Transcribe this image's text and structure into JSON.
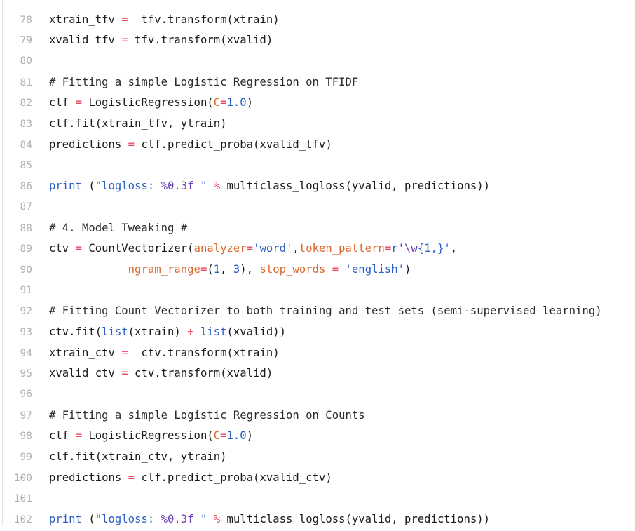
{
  "cell": {
    "language": "python",
    "background": "#ffffff",
    "line_number_color": "#b0b0b0",
    "gutter_rule_color": "#e3e3e3"
  },
  "colors": {
    "plain": "#1a1a1a",
    "comment": "#2b2b2b",
    "builtin": "#2b5fc4",
    "string": "#2b5fc4",
    "number": "#2b5fc4",
    "kwarg": "#d9662b",
    "operator": "#e8455f",
    "escape": "#6a3fb5"
  },
  "lines": [
    {
      "number": "",
      "clipped": true,
      "tokens": [
        {
          "t": "plain",
          "v": ""
        }
      ]
    },
    {
      "number": "78",
      "tokens": [
        {
          "t": "plain",
          "v": "xtrain_tfv "
        },
        {
          "t": "op",
          "v": "="
        },
        {
          "t": "plain",
          "v": "  tfv.transform(xtrain)"
        }
      ]
    },
    {
      "number": "79",
      "tokens": [
        {
          "t": "plain",
          "v": "xvalid_tfv "
        },
        {
          "t": "op",
          "v": "="
        },
        {
          "t": "plain",
          "v": " tfv.transform(xvalid)"
        }
      ]
    },
    {
      "number": "80",
      "tokens": []
    },
    {
      "number": "81",
      "tokens": [
        {
          "t": "comment",
          "v": "# Fitting a simple Logistic Regression on TFIDF"
        }
      ]
    },
    {
      "number": "82",
      "tokens": [
        {
          "t": "plain",
          "v": "clf "
        },
        {
          "t": "op",
          "v": "="
        },
        {
          "t": "plain",
          "v": " LogisticRegression("
        },
        {
          "t": "kwarg",
          "v": "C"
        },
        {
          "t": "op",
          "v": "="
        },
        {
          "t": "number",
          "v": "1.0"
        },
        {
          "t": "plain",
          "v": ")"
        }
      ]
    },
    {
      "number": "83",
      "tokens": [
        {
          "t": "plain",
          "v": "clf.fit(xtrain_tfv, ytrain)"
        }
      ]
    },
    {
      "number": "84",
      "tokens": [
        {
          "t": "plain",
          "v": "predictions "
        },
        {
          "t": "op",
          "v": "="
        },
        {
          "t": "plain",
          "v": " clf.predict_proba(xvalid_tfv)"
        }
      ]
    },
    {
      "number": "85",
      "tokens": []
    },
    {
      "number": "86",
      "tokens": [
        {
          "t": "builtin",
          "v": "print"
        },
        {
          "t": "plain",
          "v": " ("
        },
        {
          "t": "string",
          "v": "\"logloss: "
        },
        {
          "t": "esc",
          "v": "%0.3f"
        },
        {
          "t": "string",
          "v": " \""
        },
        {
          "t": "plain",
          "v": " "
        },
        {
          "t": "op",
          "v": "%"
        },
        {
          "t": "plain",
          "v": " multiclass_logloss(yvalid, predictions))"
        }
      ]
    },
    {
      "number": "87",
      "tokens": []
    },
    {
      "number": "88",
      "tokens": [
        {
          "t": "comment",
          "v": "# 4. Model Tweaking #"
        }
      ]
    },
    {
      "number": "89",
      "tokens": [
        {
          "t": "plain",
          "v": "ctv "
        },
        {
          "t": "op",
          "v": "="
        },
        {
          "t": "plain",
          "v": " CountVectorizer("
        },
        {
          "t": "kwarg",
          "v": "analyzer"
        },
        {
          "t": "op",
          "v": "="
        },
        {
          "t": "string",
          "v": "'word'"
        },
        {
          "t": "plain",
          "v": ","
        },
        {
          "t": "kwarg",
          "v": "token_pattern"
        },
        {
          "t": "op",
          "v": "="
        },
        {
          "t": "string",
          "v": "r'"
        },
        {
          "t": "esc",
          "v": "\\w"
        },
        {
          "t": "string",
          "v": "{1,}'"
        },
        {
          "t": "plain",
          "v": ","
        }
      ]
    },
    {
      "number": "90",
      "tokens": [
        {
          "t": "plain",
          "v": "            "
        },
        {
          "t": "kwarg",
          "v": "ngram_range"
        },
        {
          "t": "op",
          "v": "="
        },
        {
          "t": "plain",
          "v": "("
        },
        {
          "t": "number",
          "v": "1"
        },
        {
          "t": "plain",
          "v": ", "
        },
        {
          "t": "number",
          "v": "3"
        },
        {
          "t": "plain",
          "v": "), "
        },
        {
          "t": "kwarg",
          "v": "stop_words"
        },
        {
          "t": "plain",
          "v": " "
        },
        {
          "t": "op",
          "v": "="
        },
        {
          "t": "plain",
          "v": " "
        },
        {
          "t": "string",
          "v": "'english'"
        },
        {
          "t": "plain",
          "v": ")"
        }
      ]
    },
    {
      "number": "91",
      "tokens": []
    },
    {
      "number": "92",
      "tokens": [
        {
          "t": "comment",
          "v": "# Fitting Count Vectorizer to both training and test sets (semi-supervised learning)"
        }
      ]
    },
    {
      "number": "93",
      "tokens": [
        {
          "t": "plain",
          "v": "ctv.fit("
        },
        {
          "t": "builtin",
          "v": "list"
        },
        {
          "t": "plain",
          "v": "(xtrain) "
        },
        {
          "t": "op",
          "v": "+"
        },
        {
          "t": "plain",
          "v": " "
        },
        {
          "t": "builtin",
          "v": "list"
        },
        {
          "t": "plain",
          "v": "(xvalid))"
        }
      ]
    },
    {
      "number": "94",
      "tokens": [
        {
          "t": "plain",
          "v": "xtrain_ctv "
        },
        {
          "t": "op",
          "v": "="
        },
        {
          "t": "plain",
          "v": "  ctv.transform(xtrain)"
        }
      ]
    },
    {
      "number": "95",
      "tokens": [
        {
          "t": "plain",
          "v": "xvalid_ctv "
        },
        {
          "t": "op",
          "v": "="
        },
        {
          "t": "plain",
          "v": " ctv.transform(xvalid)"
        }
      ]
    },
    {
      "number": "96",
      "tokens": []
    },
    {
      "number": "97",
      "tokens": [
        {
          "t": "comment",
          "v": "# Fitting a simple Logistic Regression on Counts"
        }
      ]
    },
    {
      "number": "98",
      "tokens": [
        {
          "t": "plain",
          "v": "clf "
        },
        {
          "t": "op",
          "v": "="
        },
        {
          "t": "plain",
          "v": " LogisticRegression("
        },
        {
          "t": "kwarg",
          "v": "C"
        },
        {
          "t": "op",
          "v": "="
        },
        {
          "t": "number",
          "v": "1.0"
        },
        {
          "t": "plain",
          "v": ")"
        }
      ]
    },
    {
      "number": "99",
      "tokens": [
        {
          "t": "plain",
          "v": "clf.fit(xtrain_ctv, ytrain)"
        }
      ]
    },
    {
      "number": "100",
      "tokens": [
        {
          "t": "plain",
          "v": "predictions "
        },
        {
          "t": "op",
          "v": "="
        },
        {
          "t": "plain",
          "v": " clf.predict_proba(xvalid_ctv)"
        }
      ]
    },
    {
      "number": "101",
      "tokens": []
    },
    {
      "number": "102",
      "tokens": [
        {
          "t": "builtin",
          "v": "print"
        },
        {
          "t": "plain",
          "v": " ("
        },
        {
          "t": "string",
          "v": "\"logloss: "
        },
        {
          "t": "esc",
          "v": "%0.3f"
        },
        {
          "t": "string",
          "v": " \""
        },
        {
          "t": "plain",
          "v": " "
        },
        {
          "t": "op",
          "v": "%"
        },
        {
          "t": "plain",
          "v": " multiclass_logloss(yvalid, predictions))"
        }
      ]
    }
  ]
}
